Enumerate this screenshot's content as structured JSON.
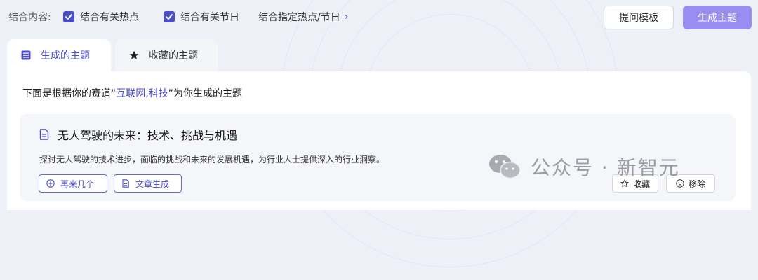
{
  "combine": {
    "label": "结合内容:",
    "options": [
      {
        "label": "结合有关热点",
        "checked": true
      },
      {
        "label": "结合有关节日",
        "checked": true
      }
    ],
    "specified_link": "结合指定热点/节日",
    "chevron": "›"
  },
  "buttons": {
    "template": "提问模板",
    "generate": "生成主题"
  },
  "tabs": [
    {
      "label": "生成的主题",
      "icon": "list-icon",
      "active": true
    },
    {
      "label": "收藏的主题",
      "icon": "star-icon",
      "active": false
    }
  ],
  "intro": {
    "prefix": "下面是根据你的赛道“",
    "track": "互联网,科技",
    "suffix": "”为你生成的主题"
  },
  "topics": [
    {
      "title": "无人驾驶的未来：技术、挑战与机遇",
      "description": "探讨无人驾驶的技术进步，面临的挑战和未来的发展机遇，为行业人士提供深入的行业洞察。",
      "actions": {
        "more": "再来几个",
        "article": "文章生成",
        "favorite": "收藏",
        "remove": "移除"
      }
    }
  ],
  "watermark": "公众号 · 新智元",
  "colors": {
    "accent": "#4b4cc9",
    "generate_bg": "#9a8df2",
    "page_bg": "#eef0f7",
    "card_bg": "#f5f6f9"
  }
}
